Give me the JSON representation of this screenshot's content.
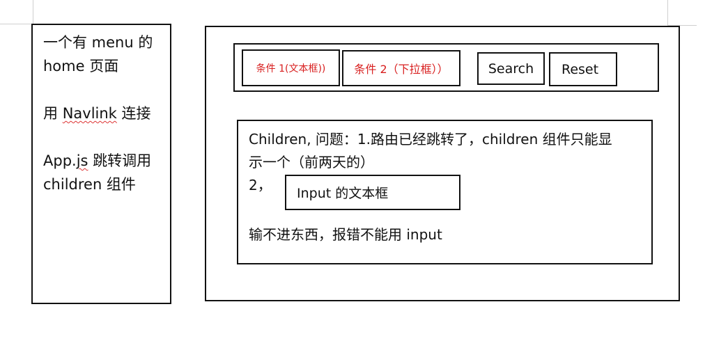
{
  "left_panel": {
    "line1": "一个有 menu 的",
    "line2": "home 页面",
    "line3_prefix": "用 ",
    "line3_link": "Navlink",
    "line3_suffix": " 连接",
    "line4_prefix": "App.",
    "line4_js": "js",
    "line4_suffix": " 跳转调用",
    "line5": "children 组件"
  },
  "search_bar": {
    "cond1": "条件 1(文本框))",
    "cond2": "条件 2（下拉框））",
    "search": "Search",
    "reset": "Reset"
  },
  "children_box": {
    "line1": "Children,  问题：1.路由已经跳转了，children 组件只能显",
    "line2": "示一个（前两天的）",
    "num2": "2，",
    "input_label": "Input 的文本框",
    "line3": "输不进东西，报错不能用 input"
  },
  "colors": {
    "border": "#111111",
    "red_text": "#d81e1e",
    "squiggle": "#d33333"
  }
}
